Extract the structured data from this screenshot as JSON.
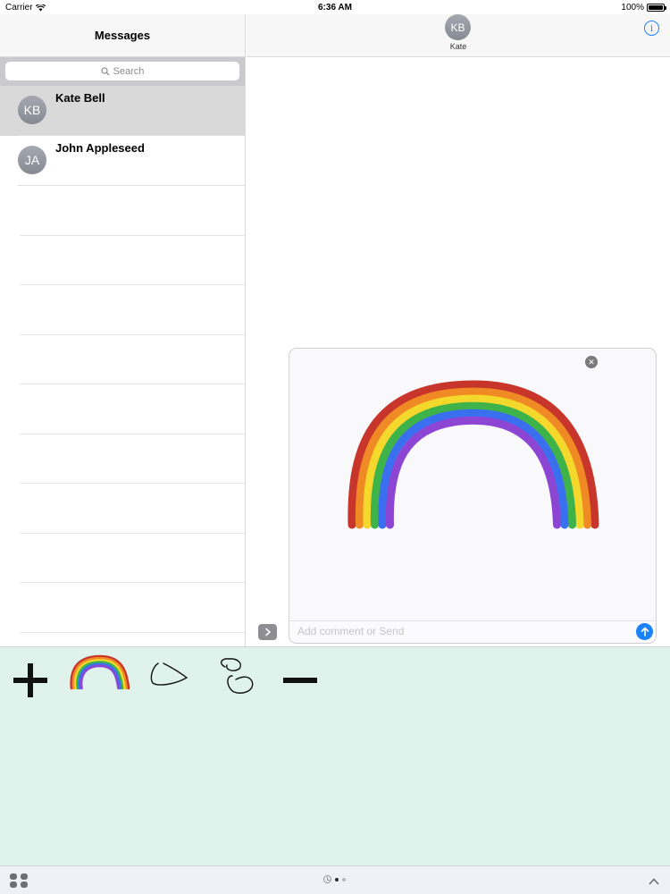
{
  "status_bar": {
    "carrier": "Carrier",
    "time": "6:36 AM",
    "battery": "100%"
  },
  "sidebar": {
    "title": "Messages",
    "search_placeholder": "Search",
    "conversations": [
      {
        "initials": "KB",
        "name": "Kate Bell",
        "selected": true
      },
      {
        "initials": "JA",
        "name": "John Appleseed",
        "selected": false
      }
    ]
  },
  "chat": {
    "initials": "KB",
    "name": "Kate",
    "info_icon": "info-icon"
  },
  "compose": {
    "comment_placeholder": "Add comment or Send",
    "rainbow_colors": [
      "#c8362b",
      "#f08a24",
      "#f4d82c",
      "#3db34a",
      "#3a6ff0",
      "#8d45d4"
    ]
  },
  "drawer": {
    "stickers": [
      "plus-sticker",
      "rainbow-sticker",
      "scribble-sticker",
      "loop-sticker",
      "minus-sticker"
    ],
    "background": "#e0f2ec"
  },
  "bottom_bar": {
    "apps_icon": "app-grid-icon",
    "collapse_icon": "chevron-up-icon"
  }
}
